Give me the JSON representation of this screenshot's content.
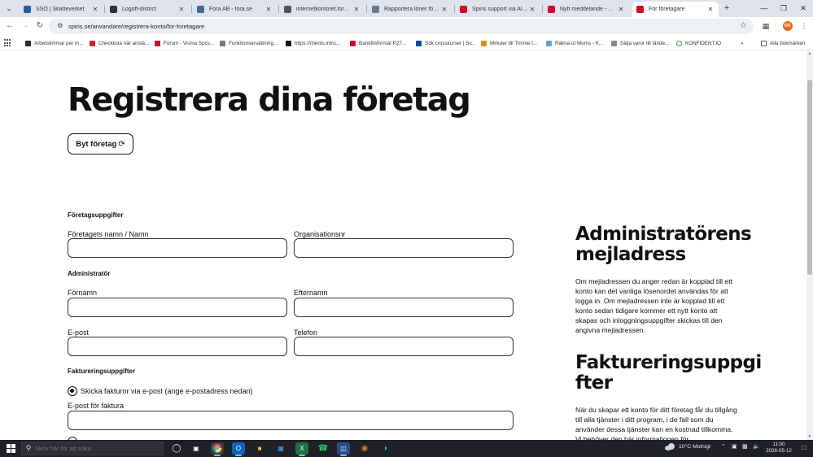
{
  "tabs": [
    {
      "title": "SSO | Skatteverket",
      "favicon_color": "#2b5aa7",
      "active": false
    },
    {
      "title": "Logoff-district",
      "favicon_color": "#333333",
      "active": false
    },
    {
      "title": "Fora AB - fora.se",
      "favicon_color": "#4a6a8a",
      "active": false
    },
    {
      "title": "internetkontoret.fora.se/i",
      "favicon_color": "#555555",
      "active": false
    },
    {
      "title": "Rapportera löner för arbe",
      "favicon_color": "#6a7a8a",
      "active": false
    },
    {
      "title": "Spiris support via AI-chatt",
      "favicon_color": "#c8102e",
      "active": false
    },
    {
      "title": "Nytt meddelande - Spiris",
      "favicon_color": "#c8102e",
      "active": false
    },
    {
      "title": "För företagare",
      "favicon_color": "#c8102e",
      "active": true
    }
  ],
  "address_bar": {
    "url": "spiris.se/anvandare/registrera-konto/for-foretagare",
    "profile_initials": "RK"
  },
  "bookmarks": [
    {
      "label": "Arbetstimmar per m...",
      "color": "#2b2b2b"
    },
    {
      "label": "Checklista när anstä...",
      "color": "#d22630"
    },
    {
      "label": "Forum - Visma Spcs...",
      "color": "#c8102e"
    },
    {
      "label": "Funktionsersättning...",
      "color": "#777777"
    },
    {
      "label": "https://clients.intru...",
      "color": "#111111"
    },
    {
      "label": "Bankfilsformat P27...",
      "color": "#c8102e"
    },
    {
      "label": "Sök crosskurser | Sv...",
      "color": "#0a4a9a"
    },
    {
      "label": "Minuter till Timme t...",
      "color": "#e08a1a"
    },
    {
      "label": "Räkna ut Moms - K...",
      "color": "#6aa0c8"
    },
    {
      "label": "Sälja varor till lände...",
      "color": "#888888"
    },
    {
      "label": "KONFIDENT.IO",
      "color": "#3a9a3a"
    }
  ],
  "all_bookmarks_label": "Alla bokmärken",
  "main": {
    "title": "Registrera dina företag",
    "switch_company_label": "Byt företag",
    "sections": {
      "company": "Företagsuppgifter",
      "admin": "Administratör",
      "billing": "Faktureringsuppgifter"
    },
    "fields": {
      "company_name": {
        "label": "Företagets namn / Namn",
        "value": ""
      },
      "org_number": {
        "label": "Organisationsnr",
        "value": ""
      },
      "first_name": {
        "label": "Förnamn",
        "value": ""
      },
      "last_name": {
        "label": "Efternamn",
        "value": ""
      },
      "email": {
        "label": "E-post",
        "value": ""
      },
      "phone": {
        "label": "Telefon",
        "value": ""
      },
      "invoice_email": {
        "label": "E-post för faktura",
        "value": ""
      }
    },
    "billing_options": {
      "email_invoice": "Skicka fakturor via e-post (ange e-postadress nedan)"
    }
  },
  "side": {
    "admin_email_heading": "Administratörens mejladress",
    "admin_email_text": "Om mejladressen du anger redan är kopplad till ett konto kan det vanliga lösenordet användas för att logga in. Om mejladressen inte är kopplad till ett konto sedan tidigare kommer ett nytt konto att skapas och inloggningsuppgifter skickas till den angivna mejladressen.",
    "billing_heading": "Faktureringsuppgi fter",
    "billing_text": "När du skapar ett konto för ditt företag får du tillgång till alla tjänster i ditt program, i de fall som du använder dessa tjänster kan en kostnad tillkomma. Vi behöver den här informationen för"
  },
  "taskbar": {
    "search_placeholder": "Skriv här för att söka",
    "weather": "10°C  Molnigt",
    "time": "11:00",
    "date": "2026-05-12"
  }
}
